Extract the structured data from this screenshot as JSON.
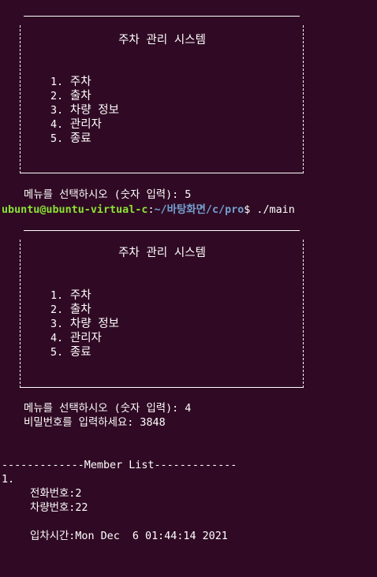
{
  "colors": {
    "background": "#300a24",
    "text": "#ffffff",
    "prompt_user": "#8ae234",
    "prompt_path": "#729fcf"
  },
  "menu": {
    "title": "주차 관리 시스템",
    "items": [
      {
        "num": "1.",
        "label": "주차"
      },
      {
        "num": "2.",
        "label": "출차"
      },
      {
        "num": "3.",
        "label": "차량 정보"
      },
      {
        "num": "4.",
        "label": "관리자"
      },
      {
        "num": "5.",
        "label": "종료"
      }
    ]
  },
  "session1": {
    "menu_prompt": "메뉴를 선택하시오 (숫자 입력): ",
    "menu_input": "5"
  },
  "shell": {
    "user_host": "ubuntu@ubuntu-virtual-c",
    "colon": ":",
    "path": "~/바탕화면/c/pro",
    "symbol": "$ ",
    "command": "./main"
  },
  "session2": {
    "menu_prompt": "메뉴를 선택하시오 (숫자 입력): ",
    "menu_input": "4",
    "password_prompt": "비밀번호를 입력하세요: ",
    "password_input": "3848"
  },
  "member_list": {
    "header": "-------------Member List-------------",
    "index": "1.",
    "phone_label": "전화번호:",
    "phone_value": "2",
    "car_label": "차량번호:",
    "car_value": "22",
    "time_label": "입차시간:",
    "time_value": "Mon Dec  6 01:44:14 2021"
  }
}
